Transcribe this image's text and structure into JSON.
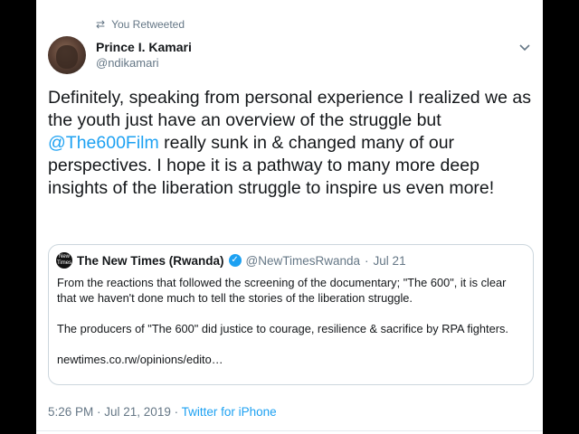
{
  "retweet": {
    "icon": "retweet-icon",
    "text": "You Retweeted"
  },
  "author": {
    "name": "Prince I. Kamari",
    "handle": "@ndikamari"
  },
  "tweet": {
    "text_before": "Definitely, speaking from personal experience I realized we as the youth just have an overview of the struggle but ",
    "mention": "@The600Film",
    "text_after": " really sunk in & changed many of our perspectives. I hope it is a pathway to many more deep insights of the liberation struggle to inspire us even more!"
  },
  "quote": {
    "logo_text_line1": "New",
    "logo_text_line2": "Times",
    "name": "The New Times (Rwanda)",
    "handle": "@NewTimesRwanda",
    "separator": "·",
    "date": "Jul 21",
    "paragraph1": "From the reactions that followed the screening of the documentary; \"The 600\", it is clear that we haven't done much to tell the stories of the liberation struggle.",
    "paragraph2": "The producers of \"The 600\" did justice to courage, resilience & sacrifice by RPA fighters.",
    "link": "newtimes.co.rw/opinions/edito…"
  },
  "footer": {
    "timestamp": "5:26 PM · Jul 21, 2019 · ",
    "source": "Twitter for iPhone"
  },
  "colors": {
    "accent": "#1da1f2",
    "text": "#14171a",
    "muted": "#657786",
    "border": "#ccd6dd"
  }
}
